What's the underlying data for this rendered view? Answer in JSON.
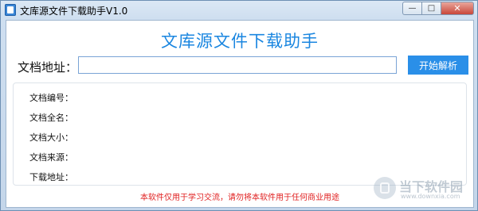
{
  "window": {
    "title": "文库源文件下载助手V1.0",
    "buttons": {
      "minimize": "—",
      "maximize": "□",
      "close": "✕"
    }
  },
  "main": {
    "heading": "文库源文件下载助手",
    "url_label": "文档地址：",
    "url_value": "",
    "parse_button": "开始解析",
    "info": {
      "doc_id": "文档编号：",
      "full_name": "文档全名：",
      "size": "文档大小：",
      "source": "文档来源：",
      "download_url": "下载地址："
    },
    "notice": "本软件仅用于学习交流，请勿将本软件用于任何商业用途"
  },
  "watermark": {
    "name": "当下软件园",
    "url": "www.downxia.com"
  },
  "colors": {
    "accent": "#1a86e0",
    "button": "#2a8fe8",
    "notice": "#e02020"
  }
}
